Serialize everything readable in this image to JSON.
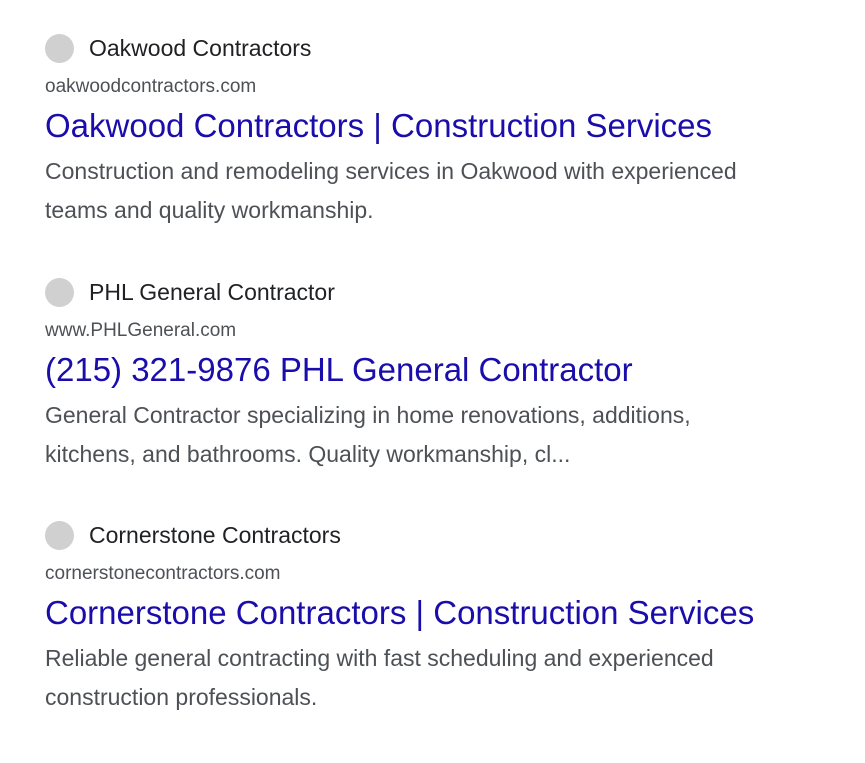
{
  "results": [
    {
      "site_name": "Oakwood Contractors",
      "url": "oakwoodcontractors.com",
      "title": "Oakwood Contractors | Construction Services",
      "snippet_line1": "Construction and remodeling services in Oakwood with experienced",
      "snippet_line2": "teams and quality workmanship."
    },
    {
      "site_name": "PHL General Contractor",
      "url": "www.PHLGeneral.com",
      "title": "(215) 321-9876 PHL General Contractor",
      "snippet_line1": "General Contractor specializing in home renovations, additions,",
      "snippet_line2": "kitchens, and bathrooms. Quality workmanship, cl..."
    },
    {
      "site_name": "Cornerstone Contractors",
      "url": "cornerstonecontractors.com",
      "title": "Cornerstone Contractors | Construction Services",
      "snippet_line1": "Reliable general contracting with fast scheduling and experienced",
      "snippet_line2": "construction professionals."
    }
  ],
  "colors": {
    "link": "#1a0dab",
    "site_name": "#202124",
    "muted_text": "#4d5156",
    "favicon_placeholder": "#d0d0d0"
  }
}
